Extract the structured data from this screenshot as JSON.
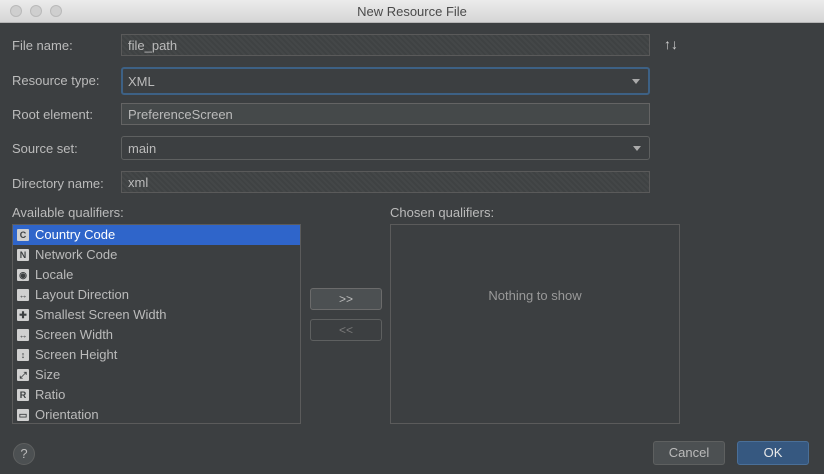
{
  "window": {
    "title": "New Resource File"
  },
  "form": {
    "file_name_label": "File name:",
    "file_name_value": "file_path",
    "resource_type_label": "Resource type:",
    "resource_type_value": "XML",
    "root_element_label": "Root element:",
    "root_element_value": "PreferenceScreen",
    "source_set_label": "Source set:",
    "source_set_value": "main",
    "directory_name_label": "Directory name:",
    "directory_name_value": "xml",
    "sort_icon": "↑↓"
  },
  "qualifiers": {
    "available_label": "Available qualifiers:",
    "chosen_label": "Chosen qualifiers:",
    "empty_text": "Nothing to show",
    "items": [
      {
        "label": "Country Code",
        "icon": "country-code-icon",
        "glyph": "C",
        "selected": true
      },
      {
        "label": "Network Code",
        "icon": "network-code-icon",
        "glyph": "N",
        "selected": false
      },
      {
        "label": "Locale",
        "icon": "globe-icon",
        "glyph": "◉",
        "selected": false
      },
      {
        "label": "Layout Direction",
        "icon": "layout-direction-icon",
        "glyph": "↔",
        "selected": false
      },
      {
        "label": "Smallest Screen Width",
        "icon": "smallest-width-icon",
        "glyph": "✚",
        "selected": false
      },
      {
        "label": "Screen Width",
        "icon": "screen-width-icon",
        "glyph": "↔",
        "selected": false
      },
      {
        "label": "Screen Height",
        "icon": "screen-height-icon",
        "glyph": "↕",
        "selected": false
      },
      {
        "label": "Size",
        "icon": "size-icon",
        "glyph": "⤢",
        "selected": false
      },
      {
        "label": "Ratio",
        "icon": "ratio-icon",
        "glyph": "R",
        "selected": false
      },
      {
        "label": "Orientation",
        "icon": "orientation-icon",
        "glyph": "▭",
        "selected": false
      }
    ],
    "add_button": ">>",
    "remove_button": "<<"
  },
  "footer": {
    "help": "?",
    "cancel": "Cancel",
    "ok": "OK"
  },
  "colors": {
    "background": "#3c3f41",
    "selection": "#2f65ca",
    "ok_button": "#365880",
    "focus_border": "#3d6185"
  }
}
